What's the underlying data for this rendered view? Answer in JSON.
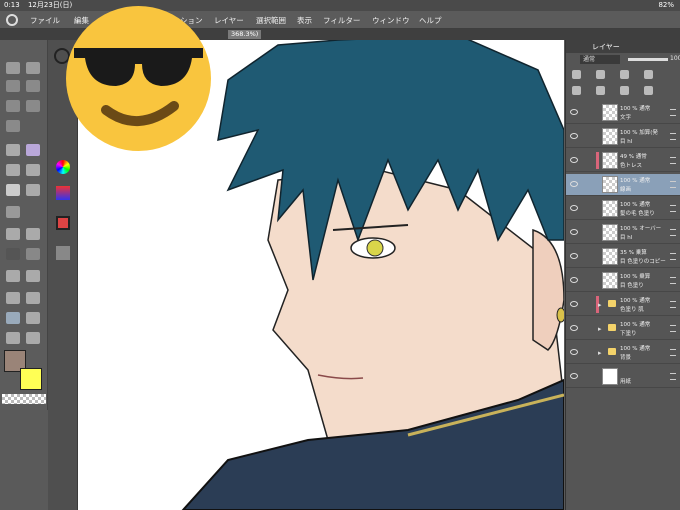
{
  "status": {
    "time": "0:13",
    "date": "12月23日(日)",
    "battery": "82%"
  },
  "menu": {
    "items": [
      "ファイル",
      "編集",
      "ション",
      "レイヤー",
      "選択範囲",
      "表示",
      "フィルター",
      "ウィンドウ",
      "ヘルプ"
    ]
  },
  "canvas_tab": {
    "label": "368.3%)"
  },
  "layer_panel": {
    "title": "レイヤー",
    "blend_mode": "通常",
    "opacity": "100",
    "layers": [
      {
        "line1": "100 % 通常",
        "line2": "文字",
        "thumb": "checker",
        "mark": ""
      },
      {
        "line1": "100 % 加算(発",
        "line2": "目 hl",
        "thumb": "checker",
        "mark": ""
      },
      {
        "line1": "49 % 通常",
        "line2": "色トレス",
        "thumb": "checker",
        "mark": "#d9657a"
      },
      {
        "line1": "100 % 通常",
        "line2": "線画",
        "thumb": "checker",
        "mark": "",
        "active": true
      },
      {
        "line1": "100 % 通常",
        "line2": "髪の毛 色塗り",
        "thumb": "checker",
        "mark": ""
      },
      {
        "line1": "100 % オーバー",
        "line2": "目 hl",
        "thumb": "checker",
        "mark": ""
      },
      {
        "line1": "35 % 乗算",
        "line2": "目 色塗りのコピー",
        "thumb": "checker",
        "mark": ""
      },
      {
        "line1": "100 % 乗算",
        "line2": "目 色塗り",
        "thumb": "checker",
        "mark": ""
      },
      {
        "line1": "100 % 通常",
        "line2": "色塗り 肌",
        "thumb": "folder",
        "mark": "#d9657a"
      },
      {
        "line1": "100 % 通常",
        "line2": "下塗り",
        "thumb": "folder",
        "mark": ""
      },
      {
        "line1": "100 % 通常",
        "line2": "背景",
        "thumb": "folder",
        "mark": ""
      },
      {
        "line1": "",
        "line2": "用紙",
        "thumb": "white",
        "mark": ""
      }
    ]
  },
  "colors": {
    "main": "#9a8478",
    "sub": "#ffff55",
    "hair": "#1f5a73",
    "skin": "#f4dccb",
    "emoji": "#f9c53e"
  }
}
